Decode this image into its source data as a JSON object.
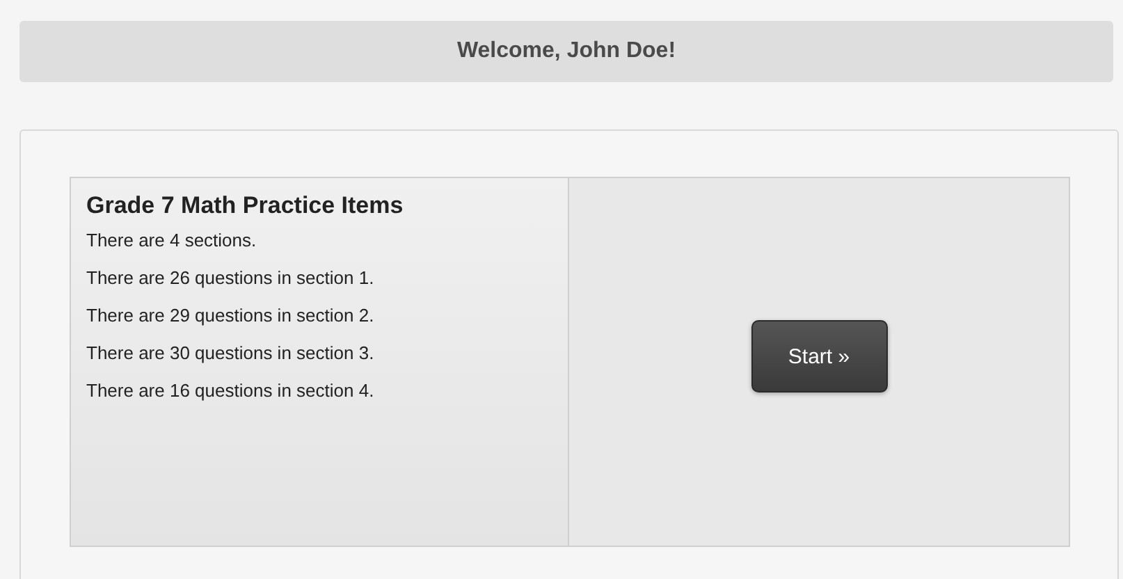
{
  "header": {
    "title": "Welcome, John Doe!"
  },
  "test": {
    "title": "Grade 7 Math Practice Items",
    "lines": [
      "There are 4 sections.",
      "There are 26 questions in section 1.",
      "There are 29 questions in section 2.",
      "There are 30 questions in section 3.",
      "There are 16 questions in section 4."
    ]
  },
  "start_button": {
    "label": "Start »"
  }
}
